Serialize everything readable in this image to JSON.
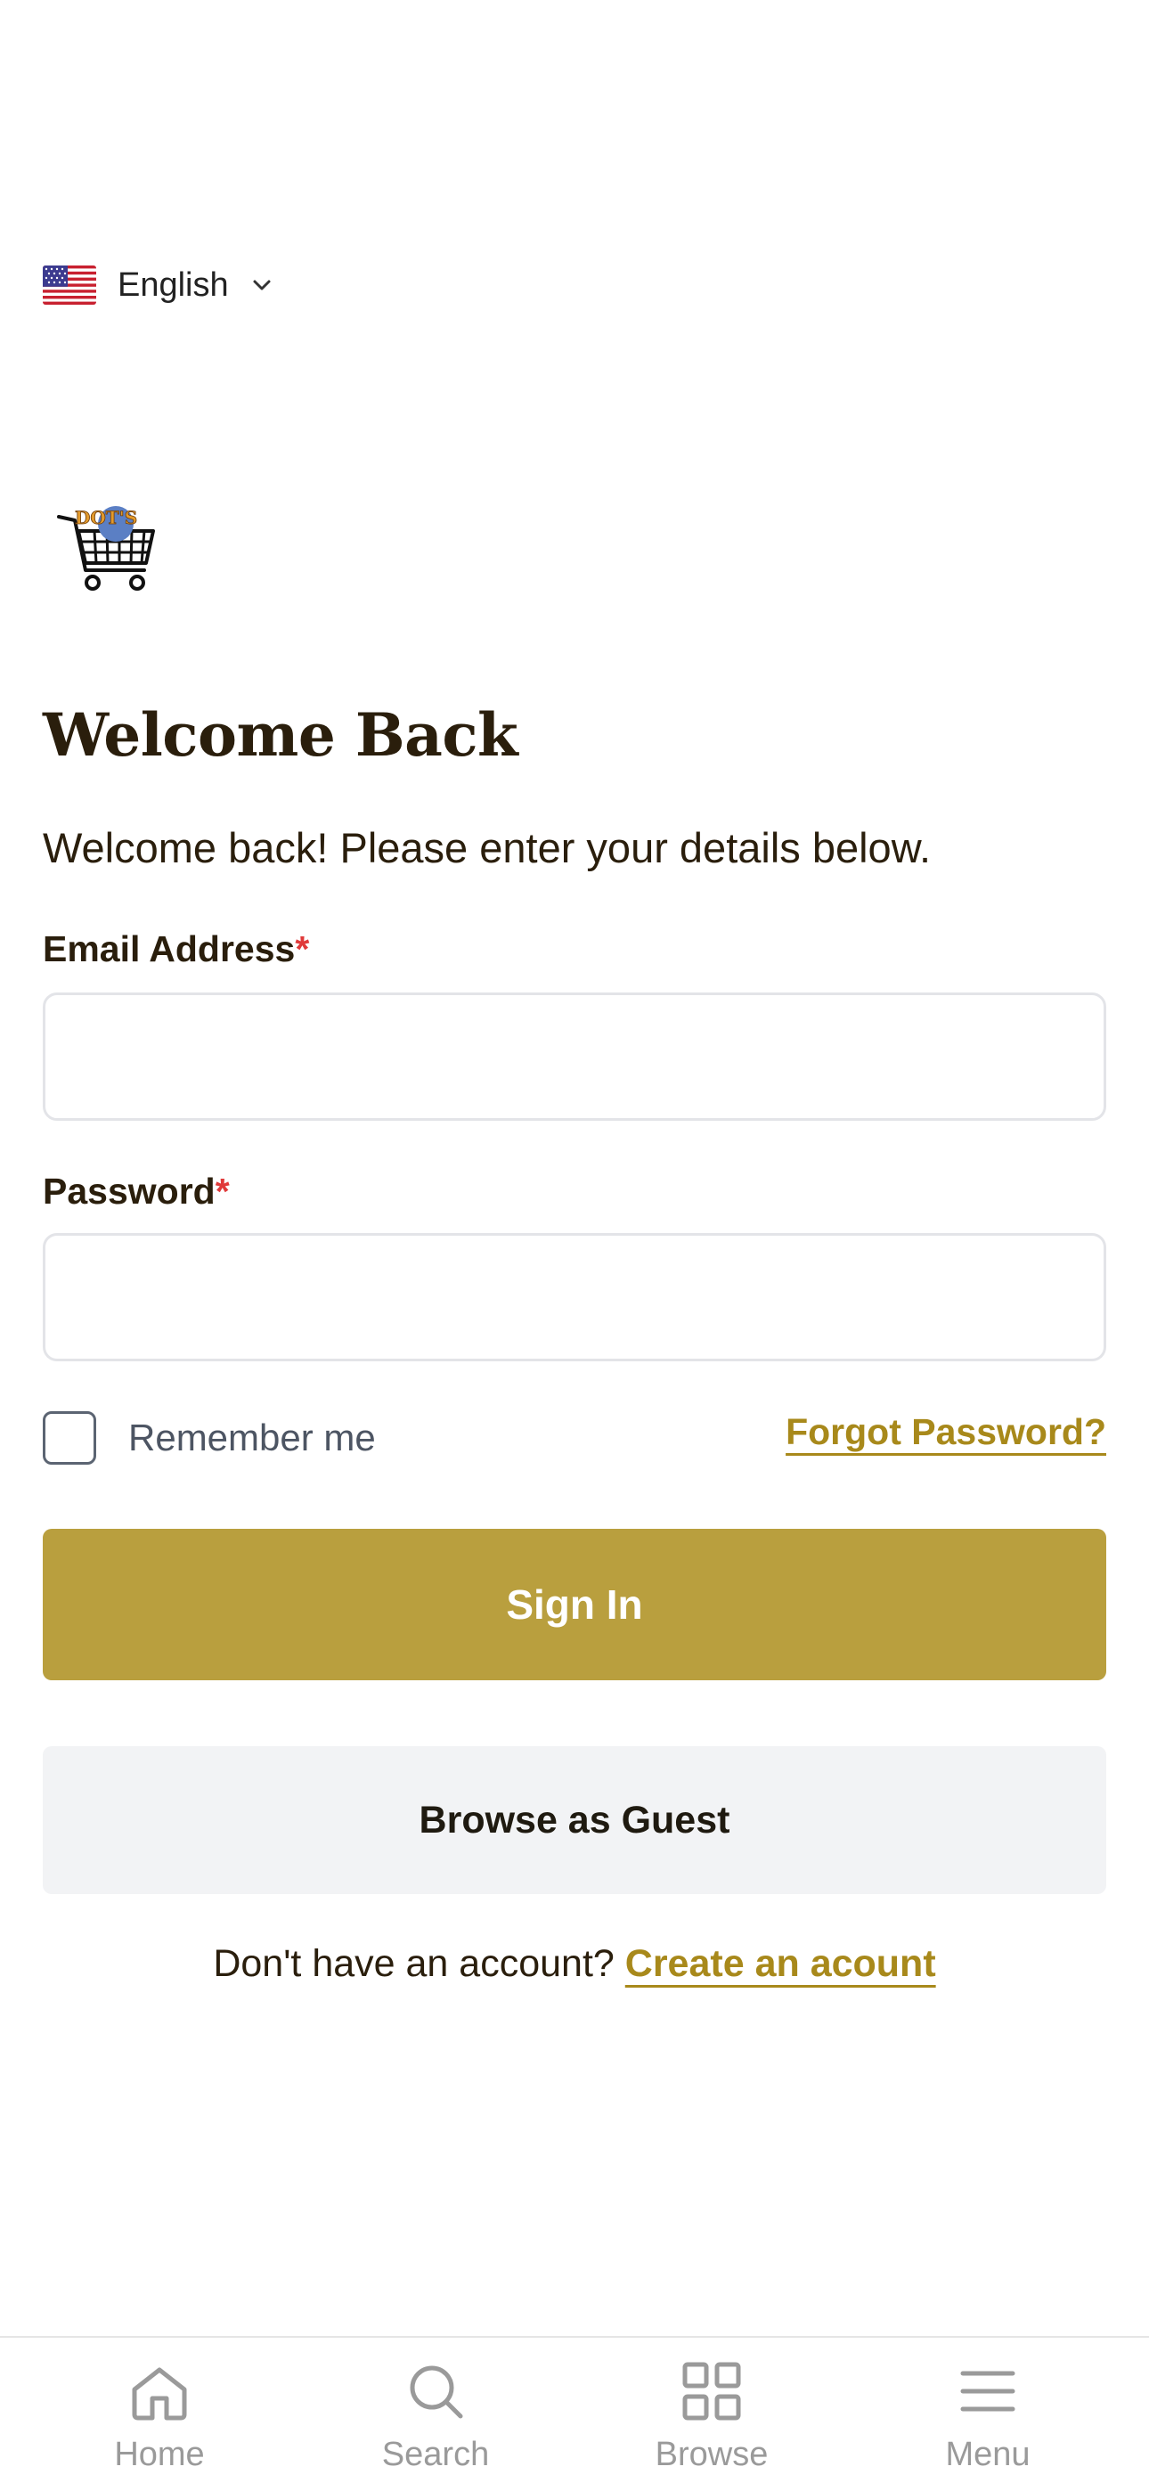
{
  "language": {
    "label": "English",
    "flag": "us-flag-icon"
  },
  "logo": {
    "text": "DOT'S"
  },
  "header": {
    "title": "Welcome Back",
    "subtitle": "Welcome back! Please enter your details below."
  },
  "form": {
    "email": {
      "label": "Email Address",
      "required_mark": "*",
      "value": "",
      "placeholder": ""
    },
    "password": {
      "label": "Password",
      "required_mark": "*",
      "value": "",
      "placeholder": ""
    },
    "remember_label": "Remember me",
    "remember_checked": false,
    "forgot_label": "Forgot Password?",
    "sign_in_label": "Sign In",
    "guest_label": "Browse as Guest"
  },
  "signup": {
    "prompt": "Don't have an account? ",
    "link": "Create an acount"
  },
  "tabbar": {
    "items": [
      {
        "label": "Home",
        "icon": "home-icon"
      },
      {
        "label": "Search",
        "icon": "search-icon"
      },
      {
        "label": "Browse",
        "icon": "grid-icon"
      },
      {
        "label": "Menu",
        "icon": "menu-icon"
      }
    ]
  },
  "colors": {
    "accent": "#b99f3e",
    "link": "#a8891b",
    "text": "#2a1e0c",
    "required": "#e03a3a",
    "guest_bg": "#f2f3f5",
    "tab_inactive": "#9a9a9a"
  }
}
